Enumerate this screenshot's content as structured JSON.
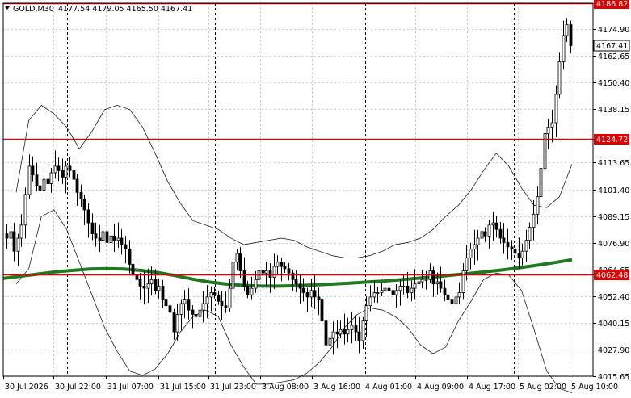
{
  "header": {
    "symbol_timeframe": "GOLD,M30",
    "ohlc": "4177.54 4179.05 4165.50 4167.41"
  },
  "chart_data": {
    "type": "candlestick",
    "symbol": "GOLD",
    "timeframe": "M30",
    "ylim": [
      4012,
      4190
    ],
    "y_ticks": [
      "4186.82",
      "4174.90",
      "4162.65",
      "4150.40",
      "4138.15",
      "4124.72",
      "4113.65",
      "4101.40",
      "4089.15",
      "4076.90",
      "4064.65",
      "4062.48",
      "4052.40",
      "4040.15",
      "4027.90",
      "4015.65"
    ],
    "x_ticks": [
      "30 Jul 2026",
      "30 Jul 22:00",
      "31 Jul 07:00",
      "31 Jul 15:00",
      "31 Jul 23:00",
      "3 Aug 08:00",
      "3 Aug 16:00",
      "4 Aug 01:00",
      "4 Aug 09:00",
      "4 Aug 17:00",
      "5 Aug 02:00",
      "5 Aug 10:00"
    ],
    "current_price": {
      "value": 4167.41,
      "label": "4167.41"
    },
    "horizontal_levels": [
      {
        "value": 4186.82,
        "label": "4186.82",
        "color": "#e00000"
      },
      {
        "value": 4124.72,
        "label": "4124.72",
        "color": "#e00000"
      },
      {
        "value": 4062.48,
        "label": "4062.48",
        "color": "#e00000"
      }
    ],
    "period_separators": [
      "31 Jul 2026",
      "3 Aug 2026",
      "4 Aug 2026",
      "5 Aug 2026"
    ],
    "grid": true,
    "colors": {
      "candles": "#000000",
      "bands": "#000000",
      "moving_average": "#1f7a1f",
      "levels": "#e00000",
      "grid": "#c8c8c8"
    },
    "series": [
      {
        "name": "close",
        "values": [
          4079,
          4082,
          4073,
          4079,
          4085,
          4099,
          4112,
          4108,
          4103,
          4101,
          4106,
          4104,
          4109,
          4112,
          4110,
          4107,
          4112,
          4110,
          4106,
          4100,
          4097,
          4092,
          4086,
          4081,
          4079,
          4078,
          4082,
          4077,
          4080,
          4078,
          4079,
          4076,
          4074,
          4067,
          4062,
          4060,
          4057,
          4056,
          4058,
          4060,
          4055,
          4057,
          4051,
          4048,
          4045,
          4036,
          4044,
          4049,
          4051,
          4046,
          4044,
          4043,
          4046,
          4049,
          4052,
          4054,
          4053,
          4050,
          4048,
          4047,
          4056,
          4068,
          4072,
          4064,
          4057,
          4053,
          4056,
          4060,
          4064,
          4063,
          4064,
          4061,
          4066,
          4068,
          4066,
          4065,
          4063,
          4060,
          4058,
          4056,
          4054,
          4052,
          4055,
          4052,
          4051,
          4041,
          4030,
          4033,
          4036,
          4035,
          4037,
          4035,
          4037,
          4039,
          4036,
          4032,
          4041,
          4048,
          4052,
          4054,
          4054,
          4055,
          4056,
          4055,
          4053,
          4055,
          4057,
          4057,
          4054,
          4056,
          4058,
          4059,
          4060,
          4060,
          4064,
          4058,
          4059,
          4056,
          4053,
          4051,
          4049,
          4052,
          4054,
          4064,
          4070,
          4074,
          4076,
          4079,
          4082,
          4080,
          4085,
          4086,
          4083,
          4079,
          4077,
          4075,
          4074,
          4072,
          4070,
          4073,
          4078,
          4084,
          4090,
          4098,
          4111,
          4127,
          4130,
          4132,
          4145,
          4160,
          4172,
          4177,
          4167.41
        ]
      },
      {
        "name": "moving_average",
        "values": [
          4060.5,
          4061.5,
          4062.5,
          4063.5,
          4064.2,
          4064.8,
          4065.0,
          4064.8,
          4064.2,
          4063.2,
          4061.8,
          4060.2,
          4058.8,
          4057.9,
          4057.3,
          4057.0,
          4057.0,
          4057.2,
          4057.5,
          4057.9,
          4058.3,
          4058.8,
          4059.3,
          4059.9,
          4060.6,
          4061.2,
          4062.0,
          4062.8,
          4063.6,
          4064.5,
          4065.5,
          4066.6,
          4067.8,
          4069.1
        ]
      },
      {
        "name": "bollinger_upper",
        "values": [
          4100,
          4133,
          4140,
          4136,
          4130,
          4120,
          4128,
          4138,
          4140,
          4138,
          4130,
          4118,
          4105,
          4095,
          4087,
          4085,
          4083,
          4079,
          4076,
          4077,
          4078,
          4079,
          4078,
          4075,
          4073,
          4071,
          4070,
          4070,
          4071,
          4073,
          4076,
          4077,
          4079,
          4083,
          4089,
          4094,
          4101,
          4110,
          4118,
          4112,
          4102,
          4094,
          4093,
          4098,
          4113
        ]
      },
      {
        "name": "bollinger_lower",
        "values": [
          4058,
          4065,
          4089,
          4092,
          4083,
          4068,
          4053,
          4038,
          4027,
          4018,
          4016,
          4019,
          4026,
          4036,
          4043,
          4046,
          4043,
          4030,
          4020,
          4012,
          4012,
          4013,
          4014,
          4017,
          4022,
          4029,
          4038,
          4044,
          4047,
          4046,
          4043,
          4038,
          4030,
          4026,
          4029,
          4041,
          4050,
          4060,
          4063,
          4062,
          4055,
          4037,
          4018,
          4010,
          4008
        ]
      }
    ]
  }
}
